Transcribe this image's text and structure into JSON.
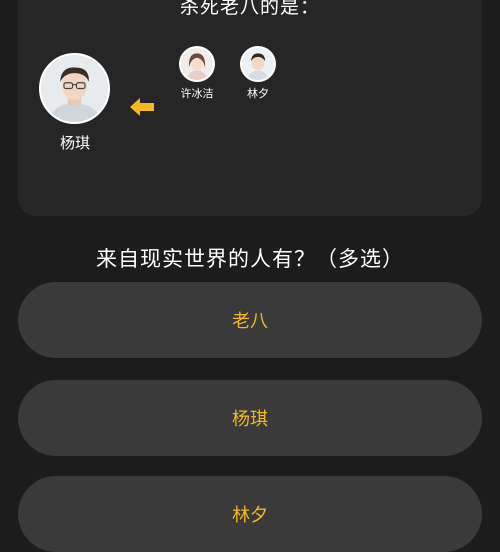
{
  "card": {
    "title": "杀死老八的是：",
    "killer": {
      "name": "杨琪",
      "icon": "avatar-photo"
    },
    "victims": [
      {
        "name": "许冰洁",
        "icon": "avatar-photo"
      },
      {
        "name": "林夕",
        "icon": "avatar-photo"
      }
    ],
    "arrow_icon": "left-arrow-icon",
    "accent_color": "#f5b820"
  },
  "question": {
    "text": "来自现实世界的人有？（多选）"
  },
  "options": [
    {
      "label": "老八"
    },
    {
      "label": "杨琪"
    },
    {
      "label": "林夕"
    }
  ]
}
